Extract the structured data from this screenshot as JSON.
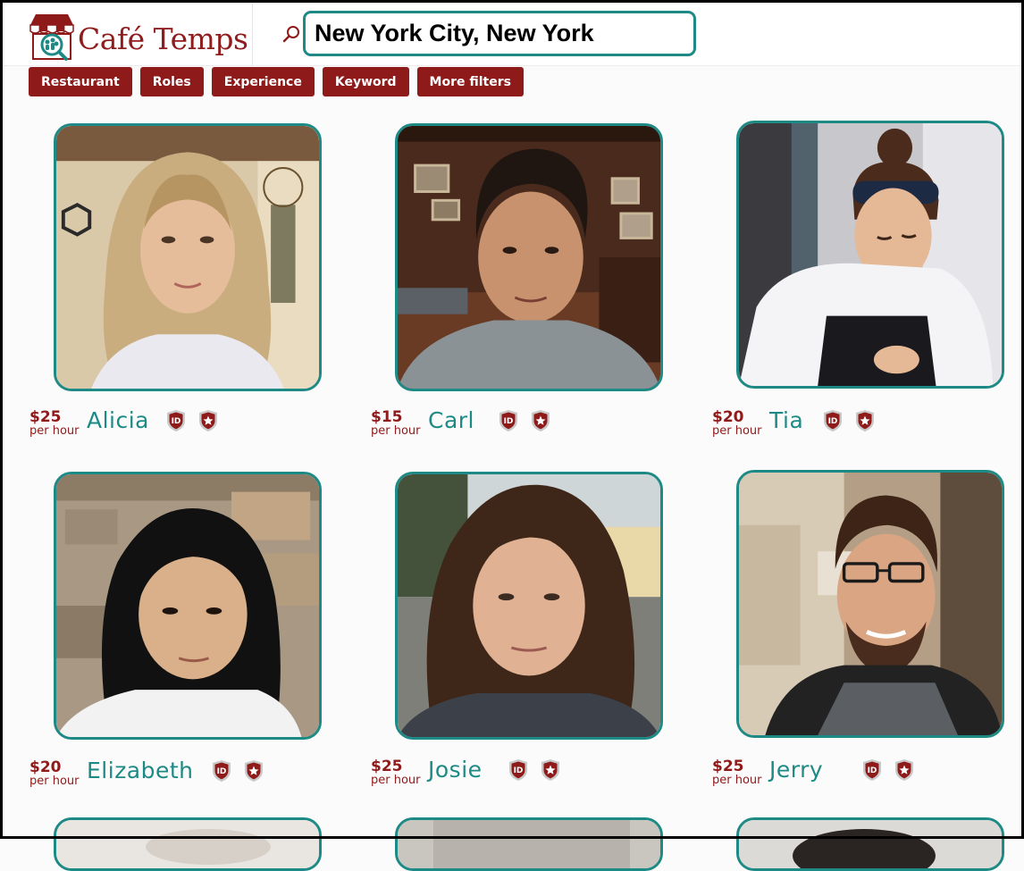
{
  "header": {
    "brand": "Café Temps",
    "search": {
      "value": "New York City, New York",
      "placeholder": ""
    }
  },
  "filters": [
    {
      "label": "Restaurant"
    },
    {
      "label": "Roles"
    },
    {
      "label": "Experience"
    },
    {
      "label": "Keyword"
    },
    {
      "label": "More filters"
    }
  ],
  "profiles": [
    {
      "name": "Alicia",
      "price": "$25",
      "unit": "per hour"
    },
    {
      "name": "Carl",
      "price": "$15",
      "unit": "per hour"
    },
    {
      "name": "Tia",
      "price": "$20",
      "unit": "per hour"
    },
    {
      "name": "Elizabeth",
      "price": "$20",
      "unit": "per hour"
    },
    {
      "name": "Josie",
      "price": "$25",
      "unit": "per hour"
    },
    {
      "name": "Jerry",
      "price": "$25",
      "unit": "per hour"
    }
  ],
  "badges": {
    "id_label": "ID"
  },
  "colors": {
    "brand": "#8f1a1a",
    "accent": "#1e8a85"
  },
  "icons": [
    "search-icon",
    "id-verified-icon",
    "star-badge-icon"
  ]
}
